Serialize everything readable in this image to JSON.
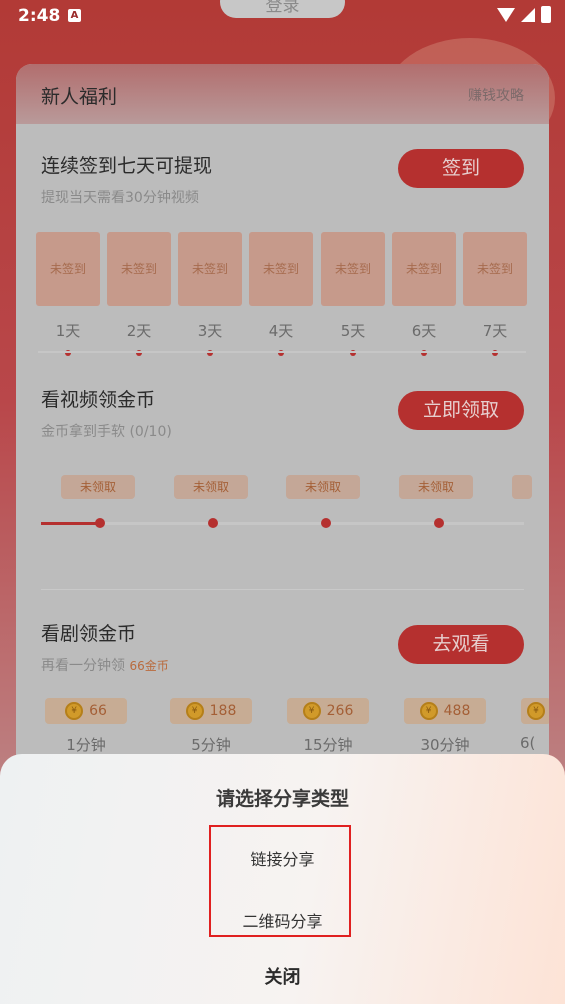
{
  "status": {
    "time": "2:48",
    "notif_letter": "A"
  },
  "header": {
    "login_label": "登录"
  },
  "card": {
    "title": "新人福利",
    "link": "赚钱攻略"
  },
  "signin": {
    "title": "连续签到七天可提现",
    "subtitle": "提现当天需看30分钟视频",
    "button": "签到",
    "days": [
      {
        "status": "未签到",
        "label": "1天"
      },
      {
        "status": "未签到",
        "label": "2天"
      },
      {
        "status": "未签到",
        "label": "3天"
      },
      {
        "status": "未签到",
        "label": "4天"
      },
      {
        "status": "未签到",
        "label": "5天"
      },
      {
        "status": "未签到",
        "label": "6天"
      },
      {
        "status": "未签到",
        "label": "7天"
      }
    ]
  },
  "video": {
    "title": "看视频领金币",
    "subtitle": "金币拿到手软 (0/10)",
    "button": "立即领取",
    "tags": [
      "未领取",
      "未领取",
      "未领取",
      "未领取"
    ],
    "progress_fraction": 0.12
  },
  "drama": {
    "title": "看剧领金币",
    "subtitle_prefix": "再看一分钟领 ",
    "subtitle_highlight": "66金币",
    "button": "去观看",
    "rewards": [
      {
        "coins": "66",
        "label": "1分钟"
      },
      {
        "coins": "188",
        "label": "5分钟"
      },
      {
        "coins": "266",
        "label": "15分钟"
      },
      {
        "coins": "488",
        "label": "30分钟"
      },
      {
        "coins": "",
        "label": "6("
      }
    ]
  },
  "share_sheet": {
    "title": "请选择分享类型",
    "options": [
      "链接分享",
      "二维码分享"
    ],
    "close": "关闭"
  },
  "colors": {
    "accent_red": "#b5302f",
    "highlight_border": "#e02020"
  }
}
